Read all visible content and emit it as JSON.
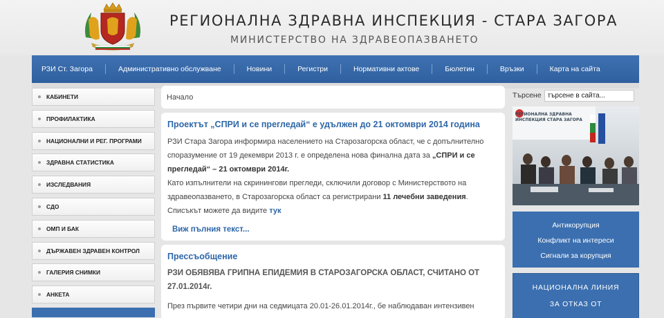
{
  "header": {
    "title": "РЕГИОНАЛНА ЗДРАВНА ИНСПЕКЦИЯ - СТАРА ЗАГОРА",
    "subtitle": "МИНИСТЕРСТВО НА ЗДРАВЕОПАЗВАНЕТО"
  },
  "nav": {
    "items": [
      "РЗИ Ст. Загора",
      "Административно обслужване",
      "Новини",
      "Регистри",
      "Нормативни актове",
      "Бюлетин",
      "Връзки",
      "Карта на сайта"
    ]
  },
  "sidebar": {
    "items": [
      "КАБИНЕТИ",
      "ПРОФИЛАКТИКА",
      "НАЦИОНАЛНИ И РЕГ. ПРОГРАМИ",
      "ЗДРАВНА СТАТИСТИКА",
      "ИЗСЛЕДВАНИЯ",
      "СДО",
      "ОМП И БАК",
      "ДЪРЖАВЕН ЗДРАВЕН КОНТРОЛ",
      "ГАЛЕРИЯ СНИМКИ",
      "АНКЕТА"
    ]
  },
  "content": {
    "breadcrumb": "Начало",
    "article1": {
      "title": "Проектът „СПРИ и се прегледай“ е удължен до 21 октомври 2014 година",
      "p1_start": "РЗИ Стара Загора информира населението на Старозагорска област, че с допълнително споразумение от 19 декември 2013 г. е определена нова финална дата за ",
      "p1_bold": "„СПРИ и се прегледай“ – 21 октомври 2014г.",
      "p2_start": "Като изпълнители на скринингови прегледи, сключили договор с Министерството на здравеопазването, в Старозагорска област са регистрирани ",
      "p2_bold": "11 лечебни заведения",
      "p2_end": ".",
      "p3_start": "Списъкът можете да видите ",
      "p3_link": "тук",
      "readmore": "Виж пълния текст..."
    },
    "article2": {
      "title": "Прессъобщение",
      "heading": "РЗИ ОБЯВЯВА ГРИПНА ЕПИДЕМИЯ В СТАРОЗАГОРСКА ОБЛАСТ, СЧИТАНО ОТ 27.01.2014г.",
      "text": "През първите четири дни на  седмицата  20.01-26.01.2014г., бе наблюдаван интензивен"
    }
  },
  "right": {
    "search_label": "Търсене",
    "search_value": "търсене в сайта...",
    "photo_sign": "РЕГИОНАЛНА ЗДРАВНА ИНСПЕКЦИЯ СТАРА ЗАГОРА",
    "links1": [
      "Антикорупция",
      "Конфликт на интереси",
      "Сигнали за корупция"
    ],
    "links2": [
      "НАЦИОНАЛНА ЛИНИЯ",
      "ЗА ОТКАЗ ОТ ТЮТЮНОПУШЕНЕ"
    ]
  },
  "colors": {
    "nav_blue": "#3b6fb0",
    "link_blue": "#2e67a8"
  }
}
